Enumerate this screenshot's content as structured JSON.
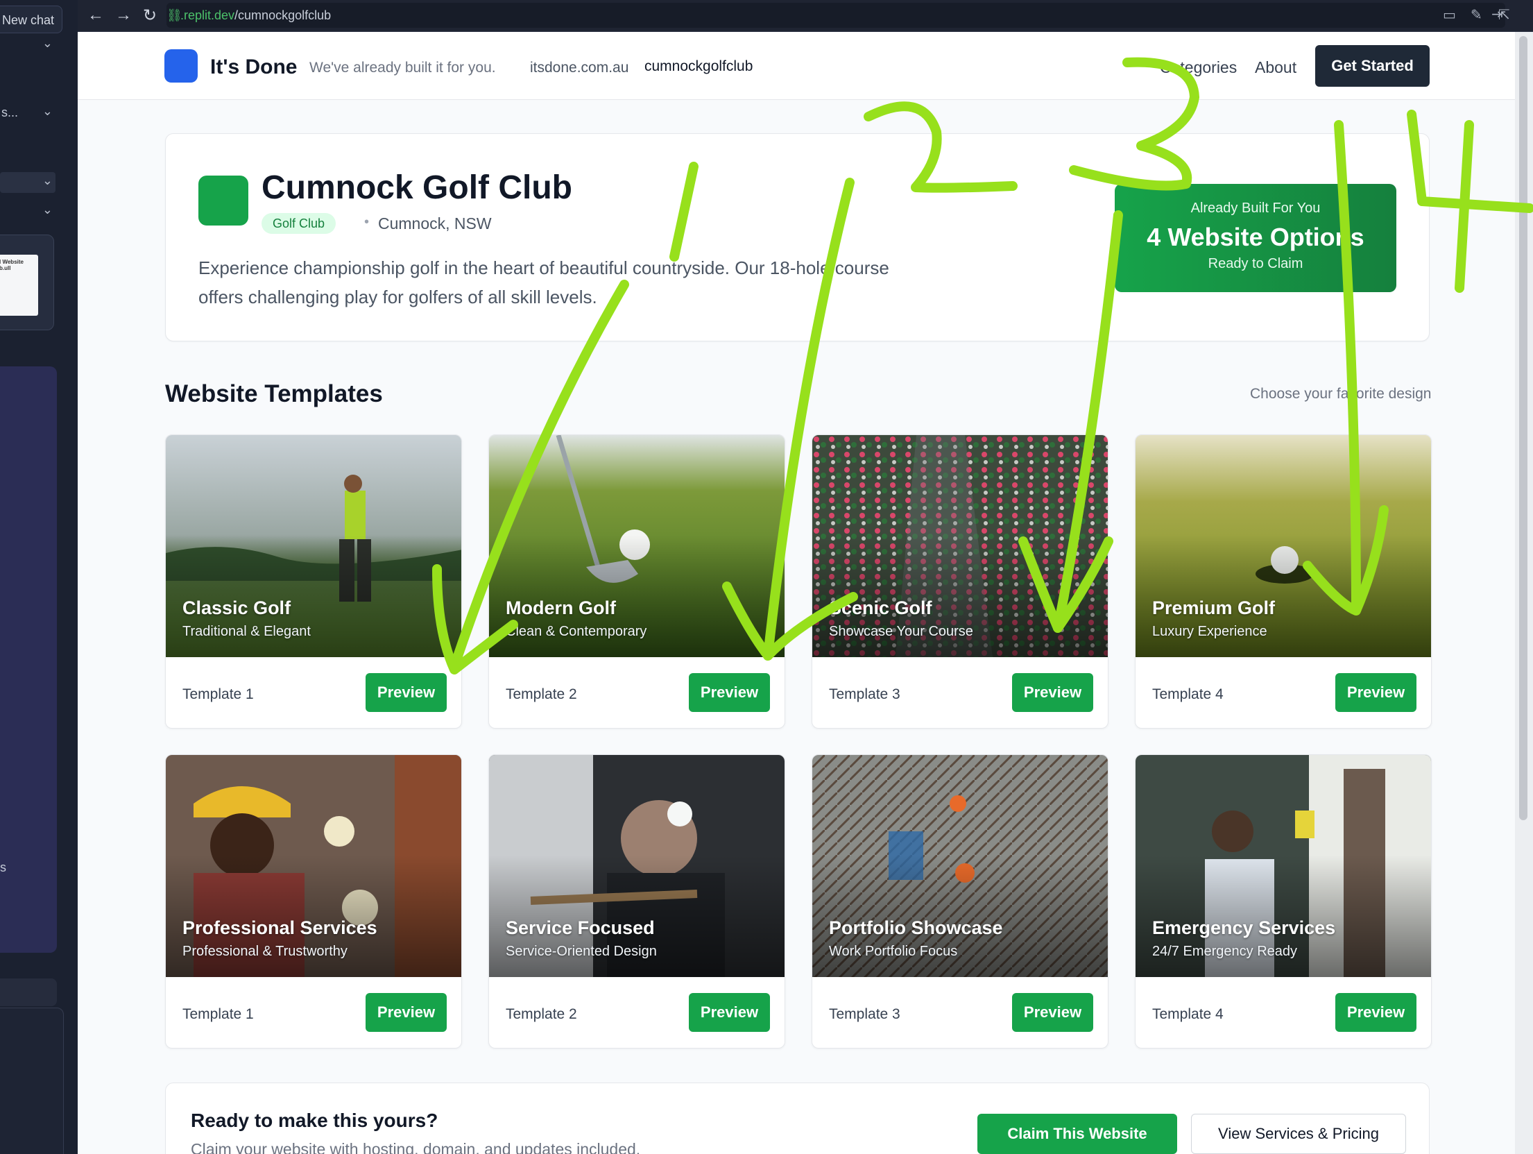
{
  "browser": {
    "sidebar_new_chat": "New chat",
    "sidebar_truncated_item": "s...",
    "sidebar_thumb_caption": "l Website\nb.ull",
    "sidebar_stray_letter": "s",
    "url_host": ".replit.dev",
    "url_path": "/cumnockgolfclub"
  },
  "header": {
    "brand": "It's Done",
    "tagline": "We've already built it for you.",
    "domain": "itsdone.com.au",
    "slug": "cumnockgolfclub",
    "nav_categories": "Categories",
    "nav_about": "About",
    "cta": "Get Started"
  },
  "hero": {
    "name": "Cumnock Golf Club",
    "category": "Golf Club",
    "location": "Cumnock, NSW",
    "description": "Experience championship golf in the heart of beautiful countryside. Our 18-hole course offers challenging play for golfers of all skill levels.",
    "options_top": "Already Built For You",
    "options_main": "4 Website Options",
    "options_bottom": "Ready to Claim"
  },
  "templates": {
    "heading": "Website Templates",
    "subheading": "Choose your favorite design",
    "row1": [
      {
        "title": "Classic Golf",
        "subtitle": "Traditional & Elegant",
        "label": "Template 1",
        "button": "Preview",
        "image": "golfer-swing-photo"
      },
      {
        "title": "Modern Golf",
        "subtitle": "Clean & Contemporary",
        "label": "Template 2",
        "button": "Preview",
        "image": "golf-ball-club-photo"
      },
      {
        "title": "Scenic Golf",
        "subtitle": "Showcase Your Course",
        "label": "Template 3",
        "button": "Preview",
        "image": "marathon-runners-photo"
      },
      {
        "title": "Premium Golf",
        "subtitle": "Luxury Experience",
        "label": "Template 4",
        "button": "Preview",
        "image": "golf-ball-hole-photo"
      }
    ],
    "row2": [
      {
        "title": "Professional Services",
        "subtitle": "Professional & Trustworthy",
        "label": "Template 1",
        "button": "Preview",
        "image": "electrician-photo"
      },
      {
        "title": "Service Focused",
        "subtitle": "Service-Oriented Design",
        "label": "Template 2",
        "button": "Preview",
        "image": "soldering-worker-photo"
      },
      {
        "title": "Portfolio Showcase",
        "subtitle": "Work Portfolio Focus",
        "label": "Template 3",
        "button": "Preview",
        "image": "construction-site-photo"
      },
      {
        "title": "Emergency Services",
        "subtitle": "24/7 Emergency Ready",
        "label": "Template 4",
        "button": "Preview",
        "image": "window-cleaner-photo"
      }
    ]
  },
  "cta": {
    "title": "Ready to make this yours?",
    "subtitle": "Claim your website with hosting, domain, and updates included.",
    "claim": "Claim This Website",
    "view": "View Services & Pricing"
  },
  "annotations": {
    "color": "#97e01c",
    "numbers": [
      "1",
      "2",
      "3",
      "4"
    ]
  },
  "colors": {
    "brand_blue": "#2563eb",
    "accent_green": "#16a34a",
    "dark": "#1f2937"
  }
}
